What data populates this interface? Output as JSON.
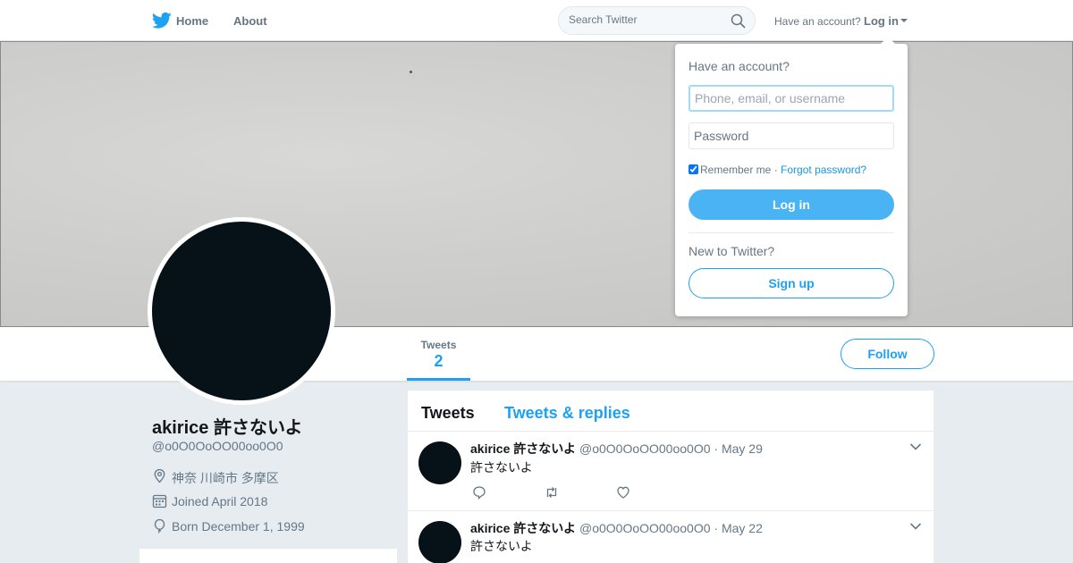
{
  "nav": {
    "home_label": "Home",
    "about_label": "About",
    "search_placeholder": "Search Twitter",
    "have_account_text": "Have an account?",
    "login_label": "Log in",
    "brand_color": "#1da1f2"
  },
  "profile": {
    "name": "akirice 許さないよ",
    "handle": "@o0O0OoOO00oo0O0",
    "location": "神奈 川崎市 多摩区",
    "joined": "Joined April 2018",
    "born": "Born December 1, 1999",
    "stats": {
      "tweets_label": "Tweets",
      "tweets_value": "2"
    },
    "follow_label": "Follow"
  },
  "timeline": {
    "tabs": [
      {
        "label": "Tweets",
        "active": true
      },
      {
        "label": "Tweets & replies",
        "active": false
      }
    ],
    "tweets": [
      {
        "name": "akirice 許さないよ",
        "handle": "@o0O0OoOO00oo0O0",
        "date": "· May 29",
        "text": "許さないよ"
      },
      {
        "name": "akirice 許さないよ",
        "handle": "@o0O0OoOO00oo0O0",
        "date": "· May 22",
        "text": "許さないよ"
      }
    ]
  },
  "login_dropdown": {
    "title": "Have an account?",
    "username_placeholder": "Phone, email, or username",
    "password_placeholder": "Password",
    "remember_label": "Remember me",
    "remember_checked": true,
    "separator": "·",
    "forgot_label": "Forgot password?",
    "login_button": "Log in",
    "new_text": "New to Twitter?",
    "signup_button": "Sign up"
  }
}
